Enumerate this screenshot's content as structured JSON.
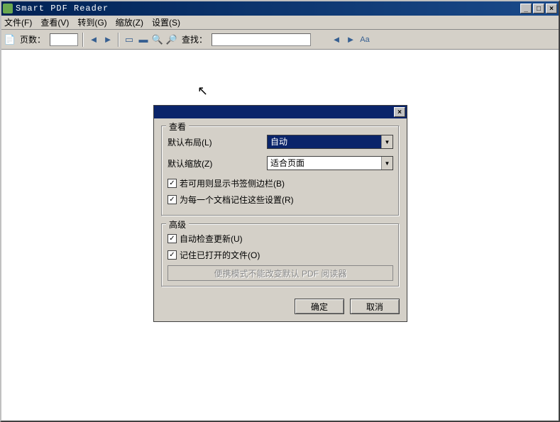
{
  "window": {
    "title": "Smart PDF Reader"
  },
  "menu": {
    "file": "文件(F)",
    "view": "查看(V)",
    "goto": "转到(G)",
    "zoom": "缩放(Z)",
    "settings": "设置(S)"
  },
  "toolbar": {
    "pages_label": "页数：",
    "find_label": "查找："
  },
  "dialog": {
    "group_view": {
      "legend": "查看",
      "default_layout_label": "默认布局(L)",
      "default_layout_value": "自动",
      "default_zoom_label": "默认缩放(Z)",
      "default_zoom_value": "适合页面",
      "show_bookmarks_label": "若可用则显示书签侧边栏(B)",
      "remember_per_doc_label": "为每一个文档记住这些设置(R)"
    },
    "group_advanced": {
      "legend": "高级",
      "auto_update_label": "自动检查更新(U)",
      "remember_opened_label": "记住已打开的文件(O)",
      "portable_note": "便携模式不能改变默认 PDF 阅读器"
    },
    "ok": "确定",
    "cancel": "取消"
  }
}
